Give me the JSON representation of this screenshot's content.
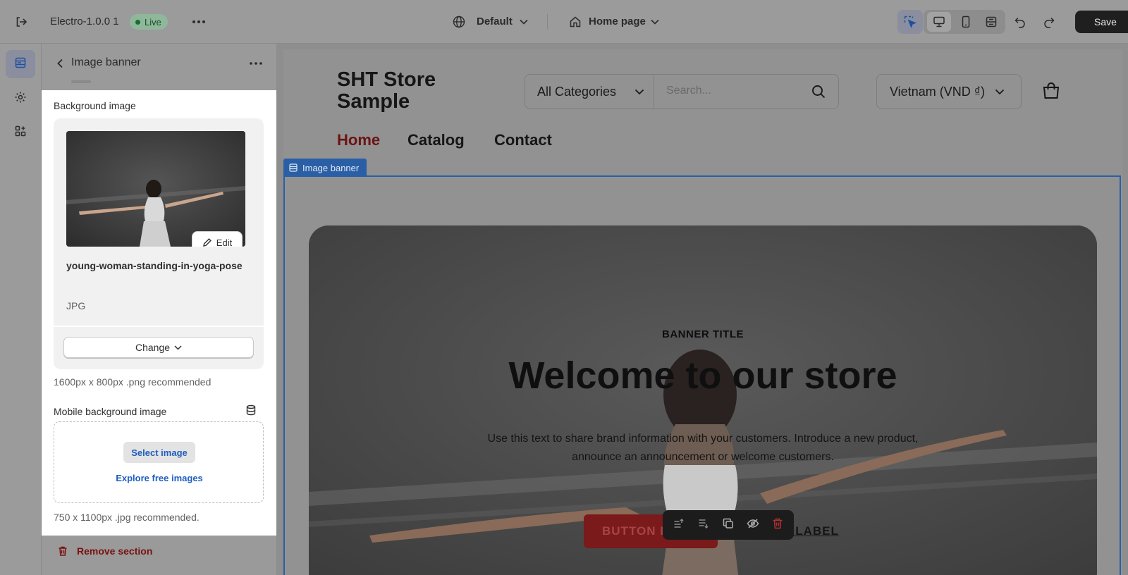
{
  "topbar": {
    "app_version": "Electro-1.0.0 1",
    "status_badge": "Live",
    "theme_selector": "Default",
    "page_selector": "Home page",
    "save_label": "Save"
  },
  "panel": {
    "title": "Image banner",
    "background_image": {
      "label": "Background image",
      "file_name": "young-woman-standing-in-yoga-pose",
      "file_type": "JPG",
      "edit_label": "Edit",
      "change_label": "Change",
      "hint": "1600px x 800px .png recommended"
    },
    "mobile_background_image": {
      "label": "Mobile background image",
      "select_label": "Select image",
      "explore_label": "Explore free images",
      "hint": "750 x 1100px .jpg recommended."
    },
    "remove_label": "Remove section"
  },
  "preview": {
    "store_name_line1": "SHT Store",
    "store_name_line2": "Sample",
    "category_selector": "All Categories",
    "search_placeholder": "Search...",
    "country_selector": "Vietnam (VND ₫)",
    "nav": [
      "Home",
      "Catalog",
      "Contact"
    ],
    "section_tag": "Image banner",
    "banner": {
      "subtitle": "BANNER TITLE",
      "heading": "Welcome to our store",
      "text_line1": "Use this text to share brand information with your customers. Introduce a new product,",
      "text_line2": "announce an announcement or welcome customers.",
      "button_label": "BUTTON LABEL",
      "link_label": "BUTTON LABEL"
    }
  },
  "colors": {
    "accent": "#2a5fa6",
    "live": "#1d6b34",
    "danger": "#7a1010",
    "active_nav": "#7a1a1a"
  }
}
